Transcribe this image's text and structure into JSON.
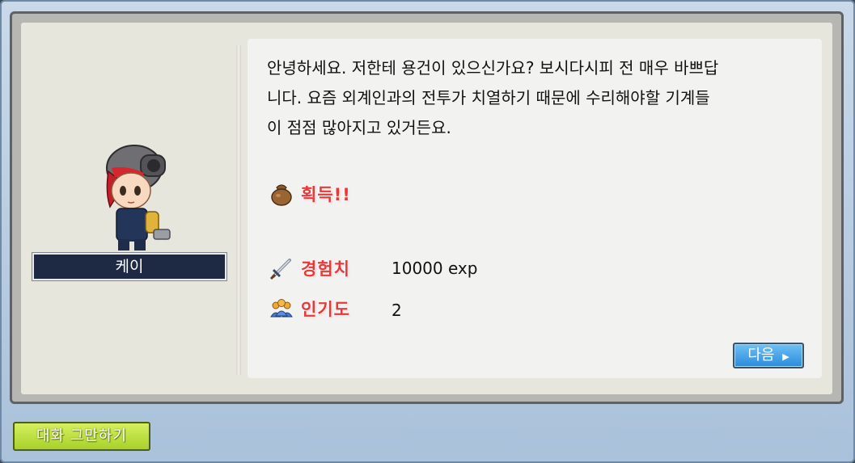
{
  "npc": {
    "name": "케이"
  },
  "dialog": {
    "lines": [
      "안녕하세요. 저한테 용건이 있으신가요? 보시다시피 전 매우 바쁘답",
      "니다. 요즘 외계인과의 전투가 치열하기 때문에 수리해야할 기계들",
      "이 점점 많아지고 있거든요."
    ]
  },
  "rewards": {
    "header": "획득!!",
    "exp_label": "경험치",
    "exp_value": "10000 exp",
    "fame_label": "인기도",
    "fame_value": "2"
  },
  "buttons": {
    "next": "다음",
    "end_chat": "대화 그만하기"
  },
  "icons": {
    "reward": "sack-icon",
    "exp": "sword-icon",
    "fame": "people-icon",
    "next_arrow": "triangle-right-icon"
  },
  "colors": {
    "reward_label": "#e43a3a",
    "nameplate": "#1e2a44",
    "next_button": "#2b8bdc",
    "end_button": "#a8d12a"
  }
}
